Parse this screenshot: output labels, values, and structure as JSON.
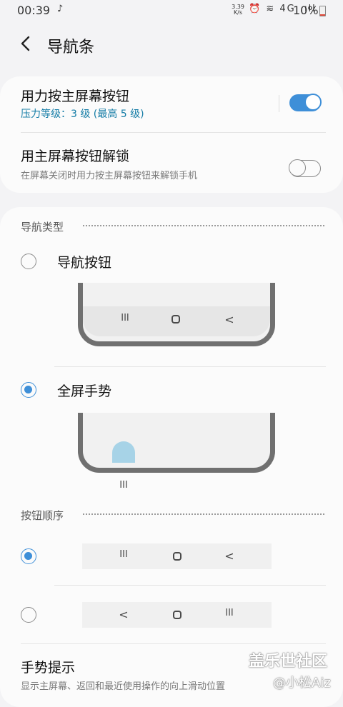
{
  "status_bar": {
    "time": "00:39",
    "tiktok_glyph": "♪",
    "speed_value": "3.39",
    "speed_unit": "K/s",
    "icons_text": "⏰ ≋ 4G .ıll",
    "battery": "10%",
    "battery_color": "#e04b3b"
  },
  "header": {
    "back_icon": "chevron-left-icon",
    "title": "导航条"
  },
  "settings": {
    "pressure": {
      "title": "用力按主屏幕按钮",
      "subtitle": "压力等级：3 级 (最高 5 级)",
      "enabled": true
    },
    "unlock": {
      "title": "用主屏幕按钮解锁",
      "subtitle": "在屏幕关闭时用力按主屏幕按钮来解锁手机",
      "enabled": false
    }
  },
  "nav_type": {
    "section_title": "导航类型",
    "options": [
      {
        "label": "导航按钮",
        "selected": false
      },
      {
        "label": "全屏手势",
        "selected": true
      }
    ],
    "buttons_preview": [
      "III",
      "O",
      "<"
    ],
    "gesture_preview": "III"
  },
  "button_order": {
    "section_title": "按钮顺序",
    "options": [
      {
        "selected": true,
        "glyphs": [
          "III",
          "O",
          "<"
        ]
      },
      {
        "selected": false,
        "glyphs": [
          "<",
          "O",
          "III"
        ]
      }
    ]
  },
  "gesture_hint": {
    "title": "手势提示",
    "subtitle": "显示主屏幕、返回和最近使用操作的向上滑动位置"
  },
  "watermark": {
    "line1": "盖乐世社区",
    "line2": "@小松Aiz"
  },
  "colors": {
    "accent": "#3e8fd8",
    "accent_text": "#147ca6",
    "background": "#f3f3f5",
    "card": "#fbfbfb"
  }
}
